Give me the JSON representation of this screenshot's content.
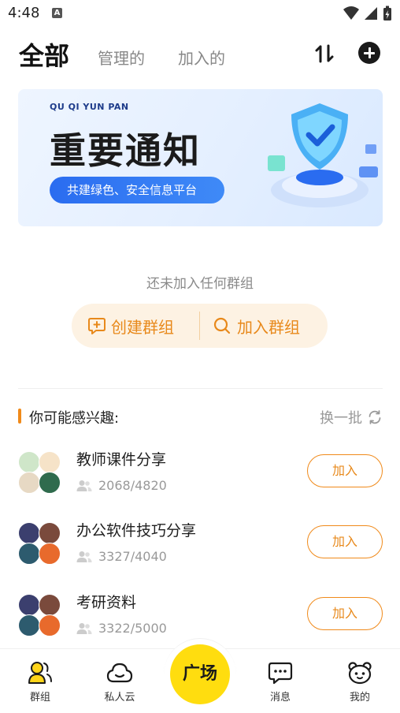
{
  "status_bar": {
    "time": "4:48",
    "notification_letter": "A"
  },
  "header": {
    "tabs": [
      {
        "label": "全部",
        "active": true
      },
      {
        "label": "管理的",
        "active": false
      },
      {
        "label": "加入的",
        "active": false
      }
    ]
  },
  "banner": {
    "subtitle": "QU QI YUN PAN",
    "title": "重要通知",
    "pill": "共建绿色、安全信息平台"
  },
  "empty_state": {
    "text": "还未加入任何群组",
    "create_label": "创建群组",
    "join_label": "加入群组"
  },
  "recommend": {
    "title": "你可能感兴趣:",
    "refresh_label": "换一批",
    "join_label": "加入",
    "groups": [
      {
        "name": "教师课件分享",
        "members": "2068/4820"
      },
      {
        "name": "办公软件技巧分享",
        "members": "3327/4040"
      },
      {
        "name": "考研资料",
        "members": "3322/5000"
      }
    ]
  },
  "bottom_nav": {
    "items": [
      {
        "label": "群组",
        "icon": "group-icon",
        "active": true
      },
      {
        "label": "私人云",
        "icon": "cloud-icon",
        "active": false
      },
      {
        "label": "广场",
        "icon": "plaza",
        "active": false
      },
      {
        "label": "消息",
        "icon": "message-icon",
        "active": false
      },
      {
        "label": "我的",
        "icon": "profile-icon",
        "active": false
      }
    ]
  },
  "colors": {
    "accent": "#f08a1a",
    "accent_bg": "#fdf2e3",
    "plaza_yellow": "#ffdd0f",
    "banner_blue": "#2a6cf0"
  }
}
